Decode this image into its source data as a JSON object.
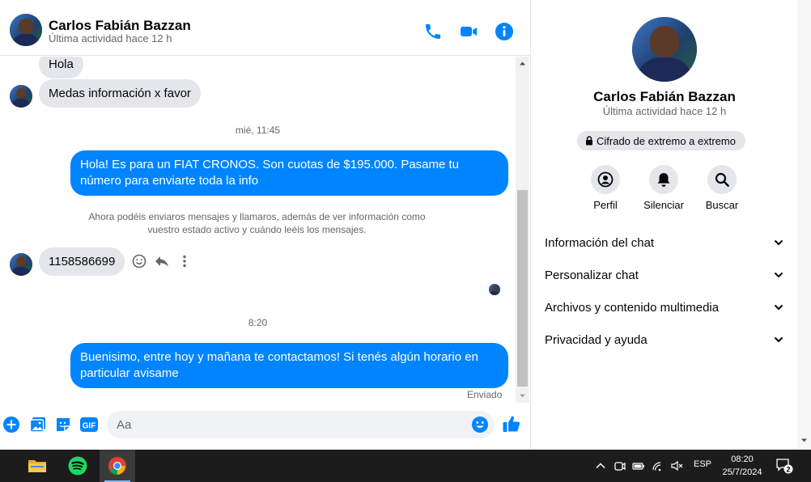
{
  "contact": {
    "name": "Carlos Fabián Bazzan",
    "status": "Última actividad hace 12 h"
  },
  "header_icons": [
    "phone-icon",
    "video-icon",
    "info-icon"
  ],
  "messages": {
    "incoming_1": "Hola",
    "incoming_2": "Medas información x favor",
    "timestamp_1": "mié, 11:45",
    "outgoing_1": "Hola! Es para un FIAT CRONOS. Son cuotas de $195.000. Pasame tu número para enviarte toda la info",
    "system_note": "Ahora podéis enviaros mensajes y llamaros, además de ver información como vuestro estado activo y cuándo leéis los mensajes.",
    "incoming_3": "1158586699",
    "timestamp_2": "8:20",
    "outgoing_2": "Buenisimo, entre hoy y mañana te contactamos! Si tenés algún horario en particular avisame",
    "sent_label": "Enviado"
  },
  "composer": {
    "placeholder": "Aa",
    "icons": [
      "plus-icon",
      "image-icon",
      "sticker-icon",
      "gif-icon",
      "emoji-icon",
      "like-icon"
    ],
    "gif_label": "GIF"
  },
  "info_panel": {
    "name": "Carlos Fabián Bazzan",
    "status": "Última actividad hace 12 h",
    "e2e_label": "Cifrado de extremo a extremo",
    "actions": [
      {
        "label": "Perfil",
        "icon": "profile-icon"
      },
      {
        "label": "Silenciar",
        "icon": "bell-icon"
      },
      {
        "label": "Buscar",
        "icon": "search-icon"
      }
    ],
    "sections": [
      {
        "label": "Información del chat"
      },
      {
        "label": "Personalizar chat"
      },
      {
        "label": "Archivos y contenido multimedia"
      },
      {
        "label": "Privacidad y ayuda"
      }
    ]
  },
  "taskbar": {
    "apps": [
      "file-explorer-icon",
      "spotify-icon",
      "chrome-icon"
    ],
    "language": "ESP",
    "time": "08:20",
    "date": "25/7/2024",
    "notification_count": "2"
  },
  "colors": {
    "accent": "#0084ff",
    "incoming_bubble": "#e4e6eb",
    "taskbar": "#1c1c1c"
  }
}
